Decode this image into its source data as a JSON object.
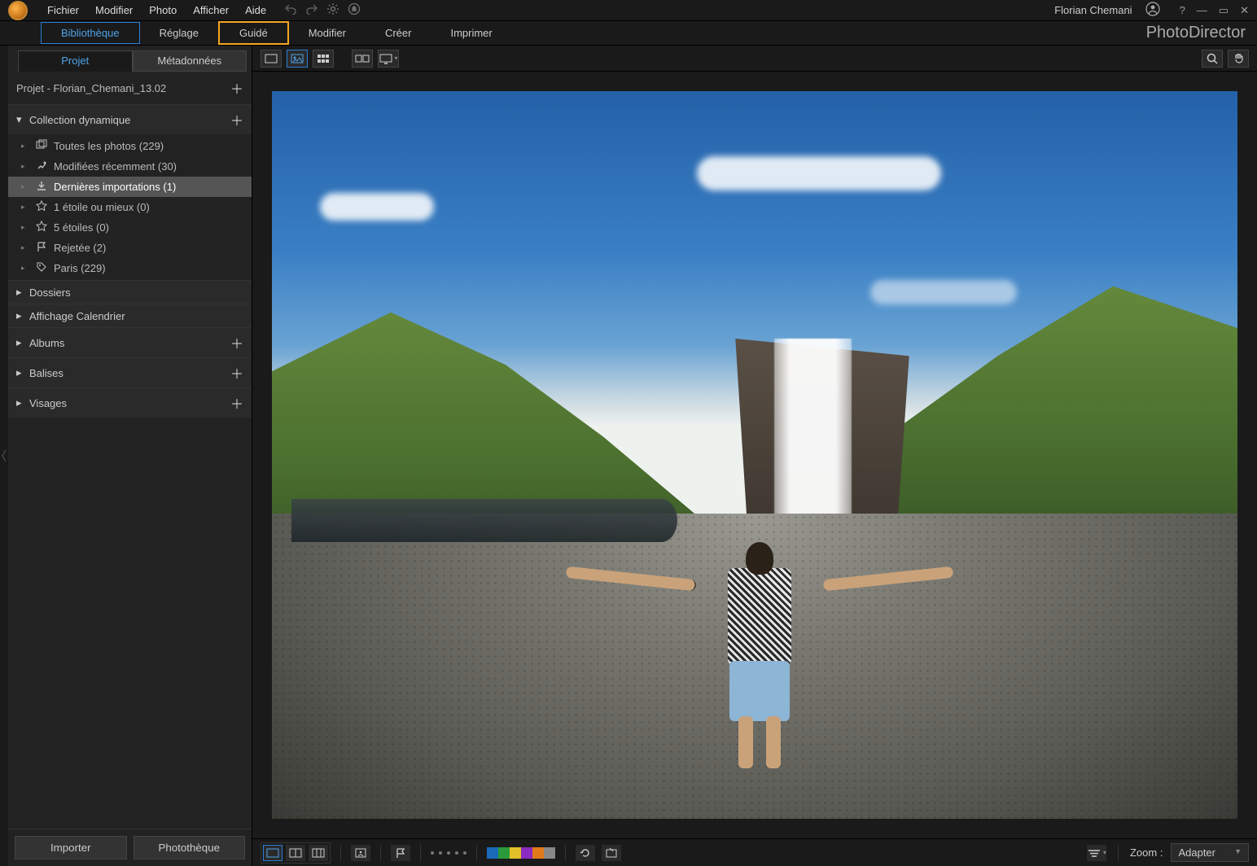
{
  "menubar": {
    "items": [
      "Fichier",
      "Modifier",
      "Photo",
      "Afficher",
      "Aide"
    ],
    "user": "Florian Chemani"
  },
  "maintabs": {
    "items": [
      {
        "label": "Bibliothèque",
        "state": "active"
      },
      {
        "label": "Réglage",
        "state": ""
      },
      {
        "label": "Guidé",
        "state": "highlight"
      },
      {
        "label": "Modifier",
        "state": ""
      },
      {
        "label": "Créer",
        "state": ""
      },
      {
        "label": "Imprimer",
        "state": ""
      }
    ],
    "brand": "PhotoDirector"
  },
  "left": {
    "tabs": {
      "project": "Projet",
      "metadata": "Métadonnées"
    },
    "project_title": "Projet - Florian_Chemani_13.02",
    "sections": {
      "collection": {
        "label": "Collection dynamique",
        "items": [
          {
            "label": "Toutes les photos (229)",
            "icon": "photos"
          },
          {
            "label": "Modifiées récemment (30)",
            "icon": "recent"
          },
          {
            "label": "Dernières importations (1)",
            "icon": "import",
            "selected": true
          },
          {
            "label": "1 étoile ou mieux (0)",
            "icon": "star"
          },
          {
            "label": "5 étoiles (0)",
            "icon": "star"
          },
          {
            "label": "Rejetée (2)",
            "icon": "reject"
          },
          {
            "label": "Paris (229)",
            "icon": "tag"
          }
        ]
      },
      "dossiers": "Dossiers",
      "calendrier": "Affichage Calendrier",
      "albums": "Albums",
      "balises": "Balises",
      "visages": "Visages"
    },
    "buttons": {
      "import": "Importer",
      "library": "Photothèque"
    }
  },
  "viewer": {
    "zoom_label": "Zoom :",
    "zoom_value": "Adapter"
  },
  "colors": [
    "#1a6ab8",
    "#2a9a3a",
    "#e2c02a",
    "#8a2ac0",
    "#e07a1a",
    "#888888"
  ]
}
